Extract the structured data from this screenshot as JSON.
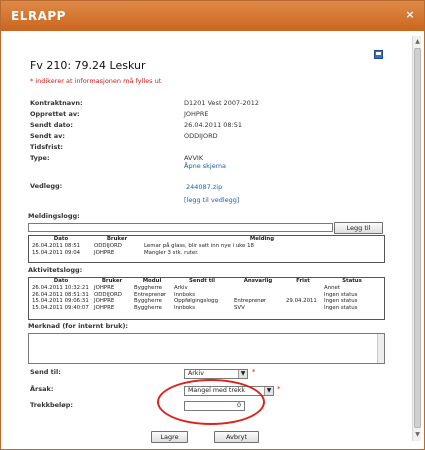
{
  "window": {
    "title": "ELRAPP",
    "close": "×"
  },
  "page": {
    "title": "Fv 210: 79.24 Leskur",
    "required_note": "* indikerer at informasjonen må fylles ut"
  },
  "fields": {
    "kontraktnavn_label": "Kontraktnavn:",
    "kontraktnavn": "D1201 Vest 2007-2012",
    "opprettet_label": "Opprettet av:",
    "opprettet": "JOHPRE",
    "sendt_dato_label": "Sendt dato:",
    "sendt_dato": "26.04.2011 08:51",
    "sendt_av_label": "Sendt av:",
    "sendt_av": "ODDIJORD",
    "tidsfrist_label": "Tidsfrist:",
    "type_label": "Type:",
    "type": "AVVIK",
    "type_link": "Åpne skjema",
    "vedlegg_label": "Vedlegg:",
    "vedlegg_file": "244087.zip",
    "vedlegg_add": "[legg til vedlegg]"
  },
  "meldingslogg": {
    "label": "Meldingslogg:",
    "button": "Legg til",
    "columns": [
      "Dato",
      "Bruker",
      "Melding"
    ],
    "rows": [
      [
        "26.04.2011 08:51",
        "ODDIJORD",
        "Lemar på glass, blir satt inn nye i uke 18"
      ],
      [
        "15.04.2011 09:04",
        "JOHPRE",
        "Mangler 3 stk. ruter."
      ]
    ]
  },
  "aktivitetslogg": {
    "label": "Aktivitetslogg:",
    "columns": [
      "Dato",
      "Bruker",
      "Modul",
      "Sendt til",
      "Ansvarlig",
      "Frist",
      "Status"
    ],
    "rows": [
      [
        "26.04.2011 10:32:21",
        "JOHPRE",
        "Byggherre",
        "Arkiv",
        "",
        "",
        "Annet"
      ],
      [
        "26.04.2011 08:51:31",
        "ODDIJORD",
        "Entreprenør",
        "Innboks",
        "",
        "",
        "Ingen status"
      ],
      [
        "15.04.2011 09:06:31",
        "JOHPRE",
        "Byggherre",
        "Oppfølgingslogg",
        "Entreprenør",
        "29.04.2011",
        "Ingen status"
      ],
      [
        "15.04.2011 09:40:07",
        "JOHPRE",
        "Byggherre",
        "Innboks",
        "SVV",
        "",
        "Ingen status"
      ]
    ]
  },
  "merknad": {
    "label": "Merknad (for internt bruk):"
  },
  "form": {
    "send_til_label": "Send til:",
    "send_til_value": "Arkiv",
    "arsak_label": "Årsak:",
    "arsak_value": "Mangel med trekk",
    "trekk_label": "Trekkbeløp:",
    "trekk_value": "0",
    "star": "*"
  },
  "buttons": {
    "save": "Lagre",
    "cancel": "Avbryt"
  }
}
